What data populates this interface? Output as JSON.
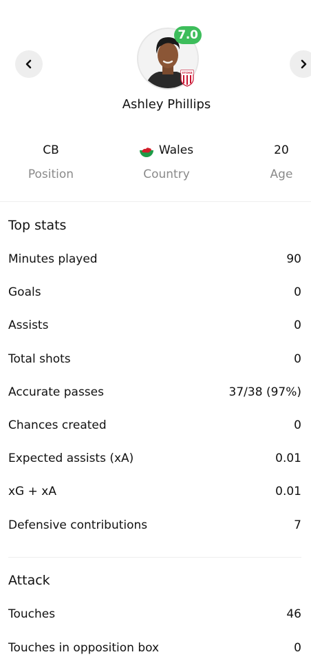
{
  "header": {
    "prev_icon": "chevron-left-icon",
    "next_icon": "chevron-right-icon",
    "rating": "7.0",
    "rating_color": "#3dbd5b",
    "player_name": "Ashley Phillips",
    "club_badge_icon": "stoke-city-badge-icon",
    "club_badge_text": "STOKE"
  },
  "info": {
    "position": {
      "value": "CB",
      "label": "Position"
    },
    "country": {
      "value": "Wales",
      "label": "Country",
      "flag_icon": "wales-flag-icon"
    },
    "age": {
      "value": "20",
      "label": "Age"
    }
  },
  "top_stats": {
    "title": "Top stats",
    "rows": [
      {
        "label": "Minutes played",
        "value": "90"
      },
      {
        "label": "Goals",
        "value": "0"
      },
      {
        "label": "Assists",
        "value": "0"
      },
      {
        "label": "Total shots",
        "value": "0"
      },
      {
        "label": "Accurate passes",
        "value": "37/38 (97%)"
      },
      {
        "label": "Chances created",
        "value": "0"
      },
      {
        "label": "Expected assists (xA)",
        "value": "0.01"
      },
      {
        "label": "xG + xA",
        "value": "0.01"
      },
      {
        "label": "Defensive contributions",
        "value": "7"
      }
    ]
  },
  "attack": {
    "title": "Attack",
    "rows": [
      {
        "label": "Touches",
        "value": "46"
      },
      {
        "label": "Touches in opposition box",
        "value": "0"
      }
    ]
  }
}
